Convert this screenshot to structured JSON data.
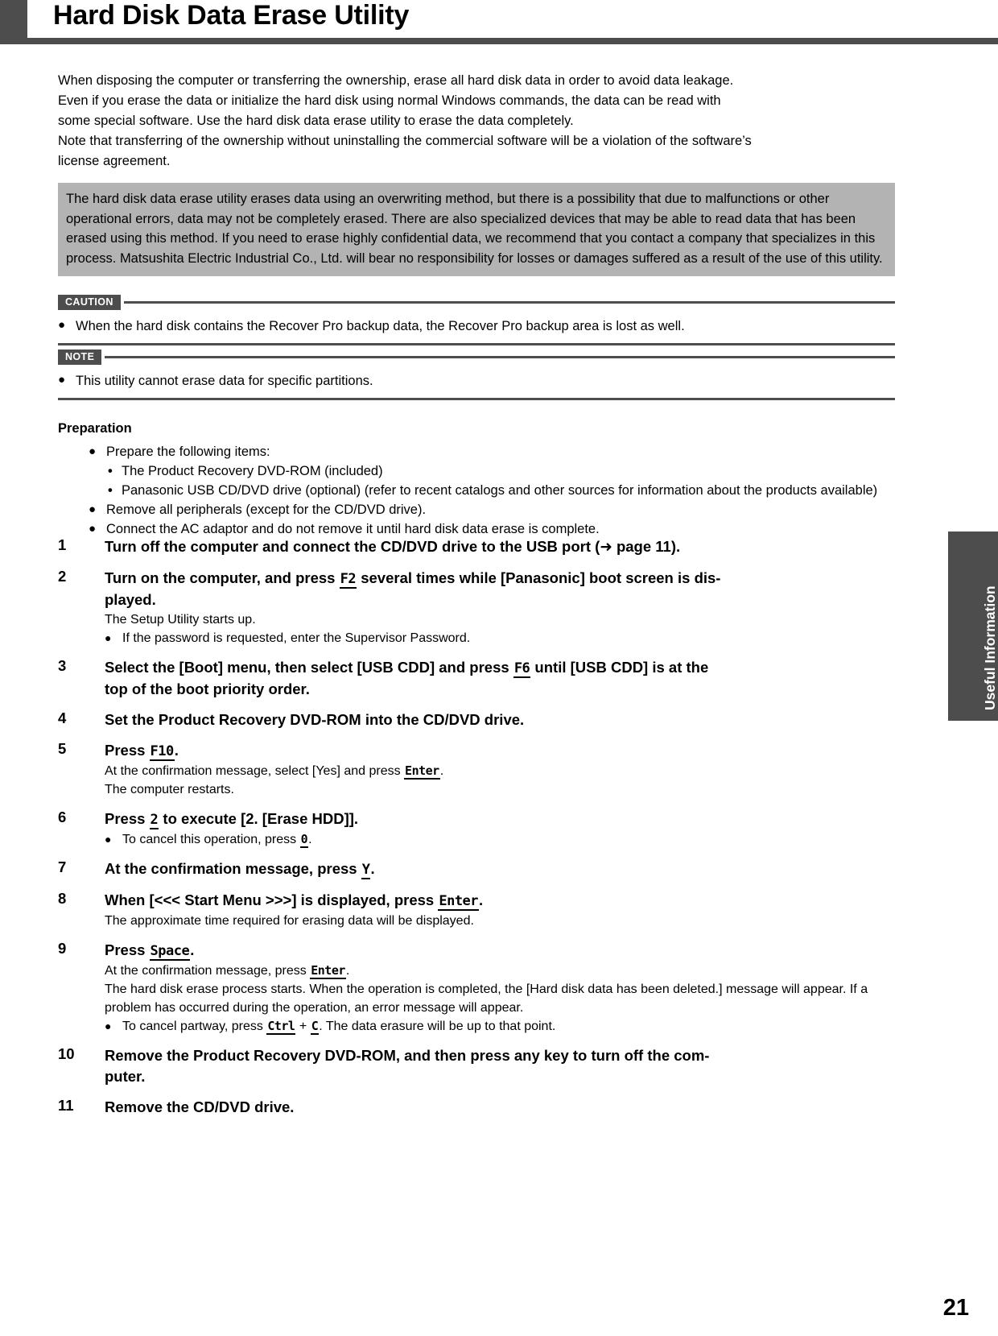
{
  "document": {
    "title": "Hard Disk Data Erase Utility",
    "page_number": "21",
    "side_tab_label": "Useful Information"
  },
  "intro": {
    "line1": "When disposing the computer or transferring the ownership, erase all hard disk data in order to avoid data leakage.",
    "line2": "Even if you erase the data or initialize the hard disk using normal Windows commands, the data can be read with",
    "line3": "some special software. Use the hard disk data erase utility to erase the data completely.",
    "line4": "Note that transferring of the ownership without uninstalling the commercial software will be a violation of the software’s",
    "line5": "license agreement."
  },
  "warning_box": {
    "text": "The hard disk data erase utility erases data using an overwriting method, but there is a possibility that due to malfunctions or other operational errors, data may not be completely erased. There are also specialized devices that may be able to read data that has been erased using this method. If you need to erase highly confidential data, we recommend that you contact a company that specializes in this process. Matsushita Electric Industrial Co., Ltd. will bear no responsibility for losses or damages suffered as a result of the use of this utility."
  },
  "caution": {
    "tag": "CAUTION",
    "item": "When the hard disk contains the Recover Pro backup data, the Recover Pro backup area is lost as well."
  },
  "note": {
    "tag": "NOTE",
    "item": "This utility cannot erase data for specific partitions."
  },
  "preparation": {
    "heading": "Preparation",
    "item1": "Prepare the following items:",
    "sub1": "The Product Recovery DVD-ROM (included)",
    "sub2_line1": "Panasonic USB CD/DVD drive (optional) (refer to recent catalogs and other sources for information about",
    "sub2_line2": "the products available)",
    "item2": "Remove all peripherals (except for the CD/DVD drive).",
    "item3": "Connect the AC adaptor and do not remove it until hard disk data erase is complete."
  },
  "steps": [
    {
      "num": "1",
      "main_a": "Turn off the computer and connect the CD/DVD drive to the USB port (",
      "arrow": "➜",
      "main_b": " page 11)."
    },
    {
      "num": "2",
      "main_a": "Turn on the computer, and press ",
      "key": "F2",
      "main_b": " several times while [Panasonic] boot screen is dis-",
      "main_c": "played.",
      "sub": "The Setup Utility starts up.",
      "bullet": "If the password is requested, enter the Supervisor Password."
    },
    {
      "num": "3",
      "main_a": "Select the [Boot] menu, then select [USB CDD] and press ",
      "key": "F6",
      "main_b": " until [USB CDD] is at the",
      "main_c": "top of the boot priority order."
    },
    {
      "num": "4",
      "main_a": "Set the Product Recovery DVD-ROM into the CD/DVD drive."
    },
    {
      "num": "5",
      "main_a": "Press ",
      "key": "F10",
      "main_b": ".",
      "sub_a": "At the confirmation message, select [Yes] and press ",
      "sub_key": "Enter",
      "sub_b": ".",
      "sub2": "The computer restarts."
    },
    {
      "num": "6",
      "main_a": "Press ",
      "key": "2",
      "main_b": " to execute [2. [Erase HDD]].",
      "bullet_a": "To cancel this operation, press ",
      "bullet_key": "0",
      "bullet_b": "."
    },
    {
      "num": "7",
      "main_a": "At the confirmation message, press ",
      "key": "Y",
      "main_b": "."
    },
    {
      "num": "8",
      "main_a": "When [<<< Start Menu >>>] is displayed, press ",
      "key": "Enter",
      "main_b": ".",
      "sub": "The approximate time required for erasing data will be displayed."
    },
    {
      "num": "9",
      "main_a": "Press ",
      "key": "Space",
      "main_b": ".",
      "sub_a": "At the confirmation message, press ",
      "sub_key": "Enter",
      "sub_b": ".",
      "sub2_line1": "The hard disk erase process starts. When the operation is completed, the [Hard disk data has been deleted.]",
      "sub2_line2": "message will appear. If a problem has occurred during the operation, an error message will appear.",
      "bullet_a": "To cancel partway, press ",
      "bullet_key1": "Ctrl",
      "bullet_plus": " + ",
      "bullet_key2": "C",
      "bullet_b": ". The data erasure will be up to that point."
    },
    {
      "num": "10",
      "main_a": "Remove the Product Recovery DVD-ROM, and then press any key to turn off the com-",
      "main_c": "puter."
    },
    {
      "num": "11",
      "main_a": "Remove the CD/DVD drive."
    }
  ]
}
